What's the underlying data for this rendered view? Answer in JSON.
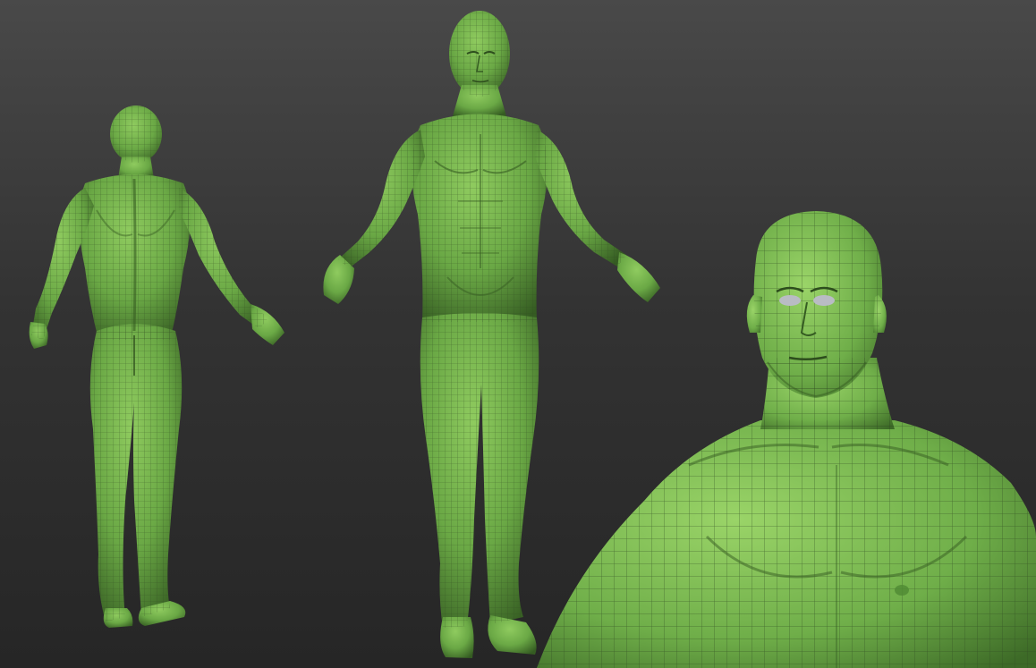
{
  "scene": {
    "kind": "3d-viewport-render",
    "background_top": "#494949",
    "background_bottom": "#262626",
    "mesh_color": "#6aa845",
    "mesh_highlight": "#8fcb5f",
    "mesh_shadow": "#355c22",
    "wire_color": "#2f4a22",
    "eye_color": "#b9bcc4"
  },
  "views": [
    {
      "name": "back-view",
      "pose": "A-pose",
      "facing": "back"
    },
    {
      "name": "front-view",
      "pose": "A-pose",
      "facing": "front"
    },
    {
      "name": "bust-closeup",
      "pose": "bust",
      "facing": "front-three-quarter"
    }
  ]
}
